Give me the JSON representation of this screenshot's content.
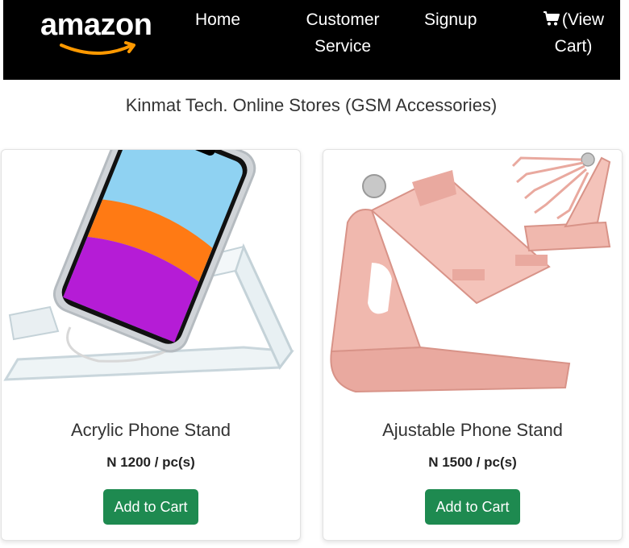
{
  "brand": {
    "logo_text": "amazon",
    "logo_icon": "amazon-smile-logo"
  },
  "nav": {
    "home": "Home",
    "customer_service_line1": "Customer",
    "customer_service_line2": "Service",
    "signup": "Signup",
    "cart_line1": "(View",
    "cart_line2": "Cart)",
    "cart_icon": "shopping-cart-icon"
  },
  "store_title": "Kinmat Tech. Online Stores (GSM Accessories)",
  "products": [
    {
      "name": "Acrylic Phone Stand",
      "price": "N 1200 / pc(s)",
      "button": "Add to Cart",
      "image_icon": "acrylic-phone-stand-image"
    },
    {
      "name": "Ajustable Phone Stand",
      "price": "N 1500 / pc(s)",
      "button": "Add to Cart",
      "image_icon": "adjustable-phone-stand-image"
    }
  ],
  "colors": {
    "navbar": "#000000",
    "button": "#1e8a50",
    "smile": "#f90"
  }
}
